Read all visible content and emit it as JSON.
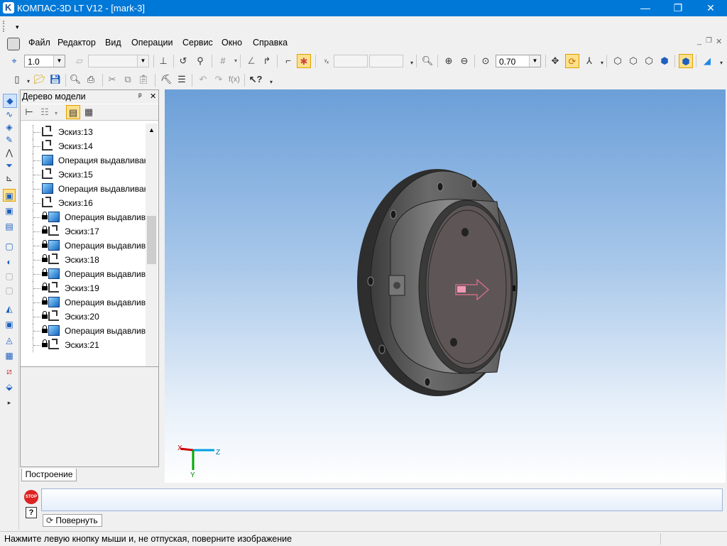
{
  "window": {
    "title": "КОМПАС-3D LT V12 - [mark-3]",
    "minimize": "—",
    "maximize": "❐",
    "close": "✕"
  },
  "menu": {
    "items": [
      "Файл",
      "Редактор",
      "Вид",
      "Операции",
      "Сервис",
      "Окно",
      "Справка"
    ]
  },
  "toolbar": {
    "step_value": "1.0",
    "zoom_value": "0.70"
  },
  "tree": {
    "title": "Дерево модели",
    "pin": "ᵖ",
    "close": "✕",
    "items": [
      {
        "label": "Эскиз:13",
        "type": "sketch",
        "locked": false
      },
      {
        "label": "Эскиз:14",
        "type": "sketch",
        "locked": false
      },
      {
        "label": "Операция выдавливания",
        "type": "extrude",
        "locked": false
      },
      {
        "label": "Эскиз:15",
        "type": "sketch",
        "locked": false
      },
      {
        "label": "Операция выдавливания",
        "type": "extrude",
        "locked": false
      },
      {
        "label": "Эскиз:16",
        "type": "sketch",
        "locked": false
      },
      {
        "label": "Операция выдавливания",
        "type": "extrude",
        "locked": true
      },
      {
        "label": "Эскиз:17",
        "type": "sketch",
        "locked": true
      },
      {
        "label": "Операция выдавливания",
        "type": "extrude",
        "locked": true
      },
      {
        "label": "Эскиз:18",
        "type": "sketch",
        "locked": true
      },
      {
        "label": "Операция выдавливания",
        "type": "extrude",
        "locked": true
      },
      {
        "label": "Эскиз:19",
        "type": "sketch",
        "locked": true
      },
      {
        "label": "Операция выдавливания",
        "type": "extrude",
        "locked": true
      },
      {
        "label": "Эскиз:20",
        "type": "sketch",
        "locked": true
      },
      {
        "label": "Операция выдавливания",
        "type": "extrude",
        "locked": true
      },
      {
        "label": "Эскиз:21",
        "type": "sketch",
        "locked": true
      }
    ],
    "tab_label": "Построение"
  },
  "axes": {
    "x": "X",
    "y": "Y",
    "z": "Z"
  },
  "bottom": {
    "rotate_label": "Повернуть",
    "stop_label": "STOP"
  },
  "status": {
    "text": "Нажмите левую кнопку мыши и, не отпуская, поверните изображение"
  },
  "colors": {
    "titlebar": "#0078d7",
    "accent": "#1e5fbf",
    "highlight": "#ffe08a"
  }
}
